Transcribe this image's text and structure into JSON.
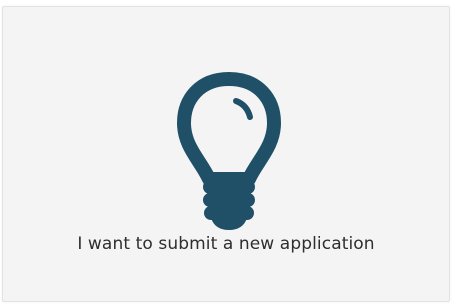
{
  "option_card": {
    "icon": "lightbulb-icon",
    "label": "I want to submit a new application",
    "icon_color": "#1f5068",
    "background_color": "#f4f4f4",
    "text_color": "#2e2e2e"
  }
}
